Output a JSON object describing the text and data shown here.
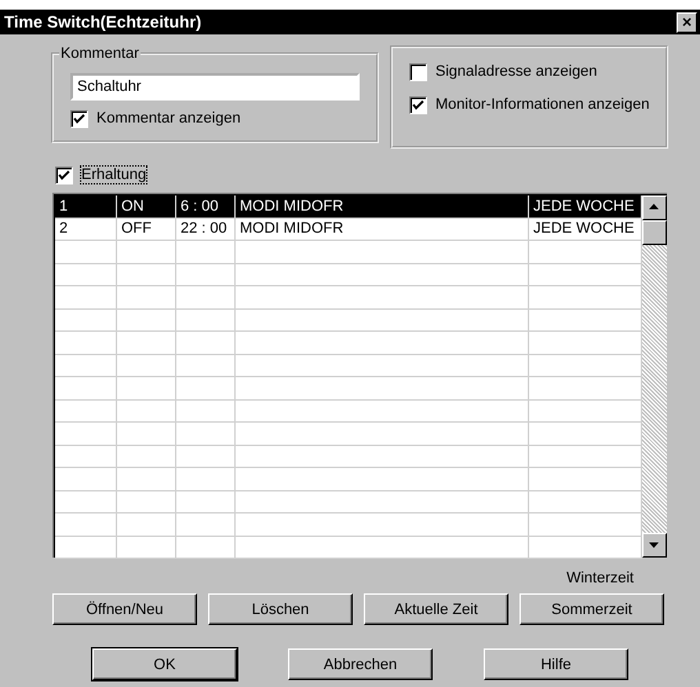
{
  "window": {
    "title": "Time Switch(Echtzeituhr)",
    "close": "×"
  },
  "comment_group": {
    "label": "Kommentar",
    "value": "Schaltuhr",
    "checkbox": {
      "label": "Kommentar anzeigen",
      "checked": true
    }
  },
  "display_options": [
    {
      "label": "Signaladresse anzeigen",
      "checked": false
    },
    {
      "label": "Monitor-Informationen anzeigen",
      "checked": true
    }
  ],
  "retain_checkbox": {
    "label": "Erhaltung",
    "checked": true
  },
  "table": {
    "rows": [
      {
        "cells": [
          "1",
          "ON",
          "6 : 00",
          "MODI MIDOFR",
          "JEDE WOCHE"
        ],
        "selected": true
      },
      {
        "cells": [
          "2",
          "OFF",
          "22 : 00",
          "MODI MIDOFR",
          "JEDE WOCHE"
        ],
        "selected": false
      }
    ]
  },
  "time_mode_label": "Winterzeit",
  "action_buttons": [
    {
      "label": "Öffnen/Neu"
    },
    {
      "label": "Löschen"
    },
    {
      "label": "Aktuelle Zeit"
    },
    {
      "label": "Sommerzeit"
    }
  ],
  "dialog_buttons": [
    {
      "label": "OK",
      "default": true
    },
    {
      "label": "Abbrechen",
      "default": false
    },
    {
      "label": "Hilfe",
      "default": false
    }
  ]
}
